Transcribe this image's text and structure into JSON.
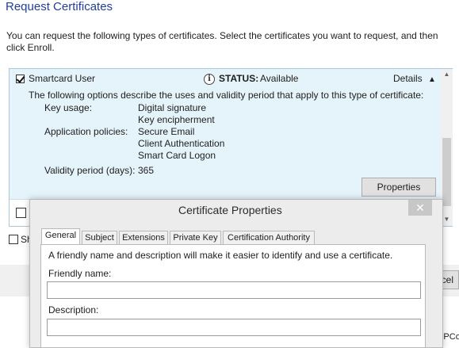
{
  "page_title": "Request Certificates",
  "intro_text": "You can request the following types of certificates. Select the certificates you want to request, and then click Enroll.",
  "certificate": {
    "name": "Smartcard User",
    "checked": true,
    "status_label": "STATUS:",
    "status_value": "Available",
    "details_label": "Details",
    "description": "The following options describe the uses and validity period that apply to this type of certificate:",
    "key_usage_label": "Key usage:",
    "key_usage_values": [
      "Digital signature",
      "Key encipherment"
    ],
    "app_policies_label": "Application policies:",
    "app_policies_values": [
      "Secure Email",
      "Client Authentication",
      "Smart Card Logon"
    ],
    "validity_label": "Validity period (days):",
    "validity_value": "365",
    "properties_button": "Properties"
  },
  "background_partial": {
    "show_all_label_fragment": "Sh",
    "cancel_fragment": "cel",
    "bottom_right_fragment": "+PCo"
  },
  "dialog": {
    "title": "Certificate Properties",
    "close_glyph": "✕",
    "tabs": [
      "General",
      "Subject",
      "Extensions",
      "Private Key",
      "Certification Authority"
    ],
    "active_tab": "General",
    "info_text": "A friendly name and description will make it easier to identify and use a certificate.",
    "friendly_name_label": "Friendly name:",
    "friendly_name_value": "",
    "description_label": "Description:",
    "description_value": ""
  },
  "colors": {
    "title_blue": "#1f3f9a",
    "panel_highlight": "#e5f3fb",
    "dialog_bg": "#ececec"
  }
}
